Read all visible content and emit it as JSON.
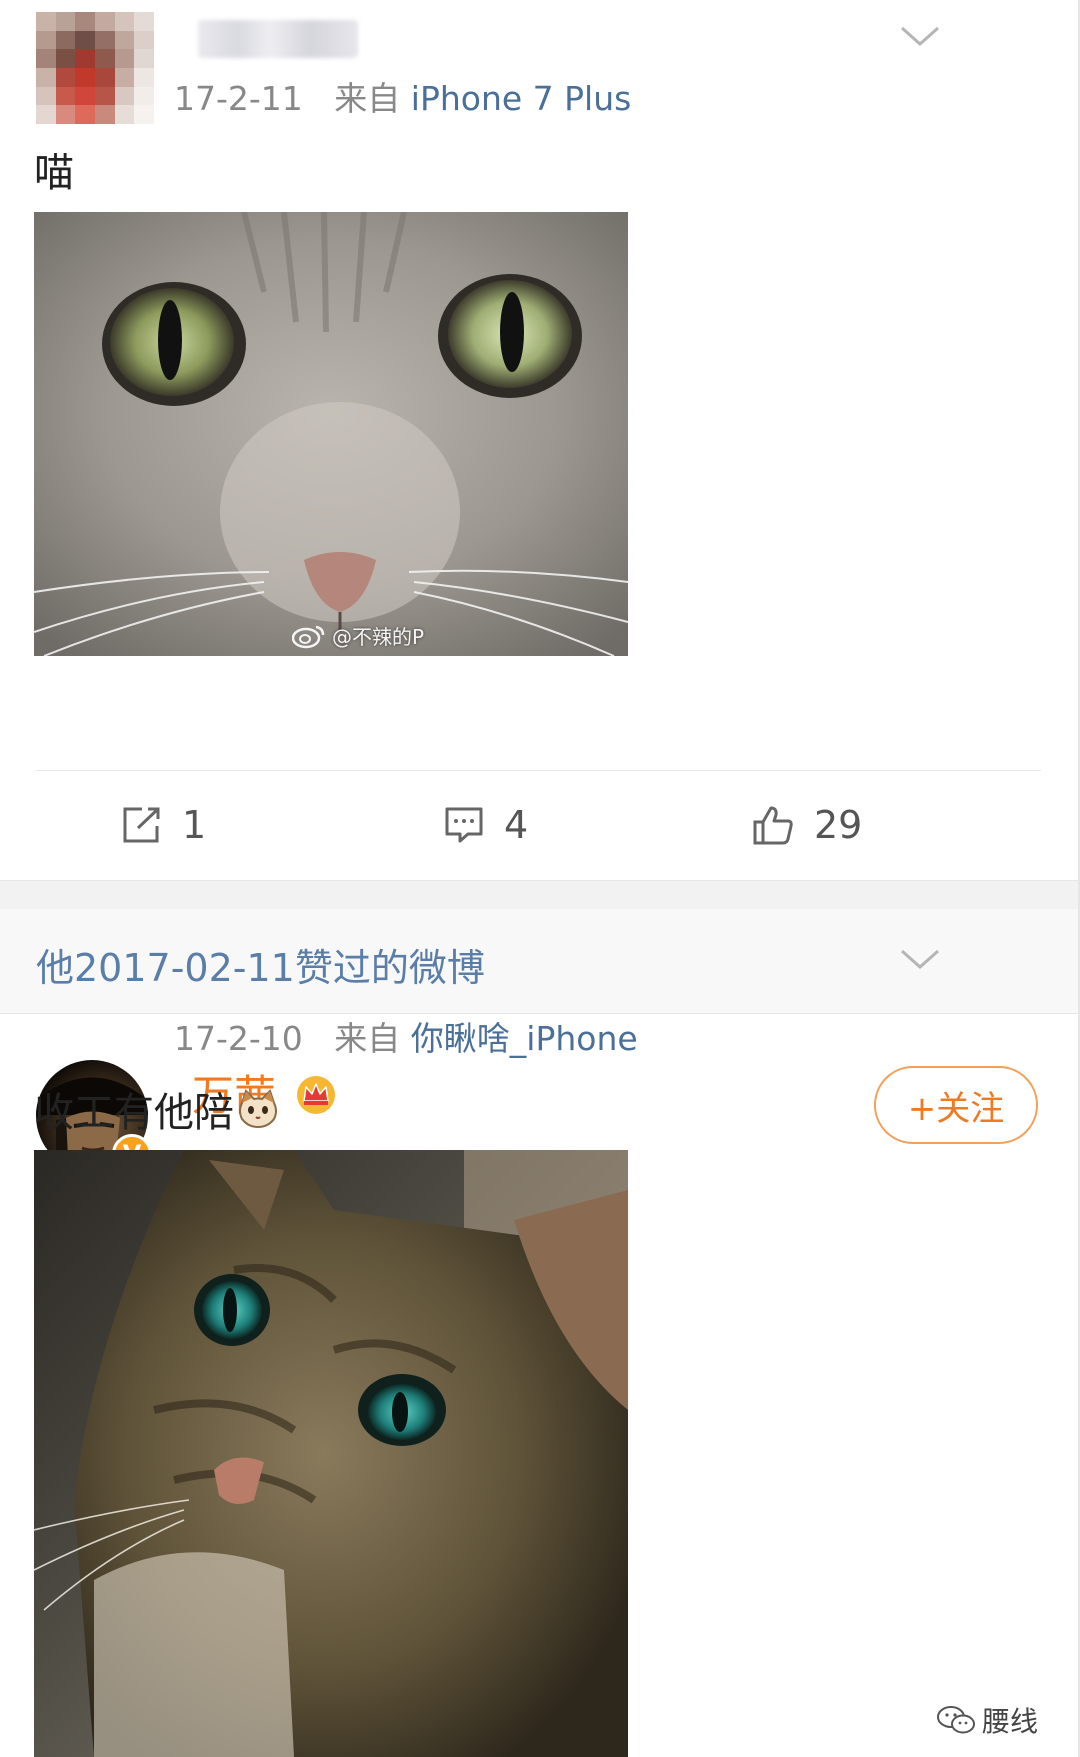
{
  "post1": {
    "date": "17-2-11",
    "source_prefix": "来自",
    "source": "iPhone 7 Plus",
    "text": "喵",
    "image_watermark": "@不辣的P",
    "actions": {
      "repost_count": "1",
      "comment_count": "4",
      "like_count": "29"
    }
  },
  "liked_section": {
    "title": "他2017-02-11赞过的微博"
  },
  "post2": {
    "username": "万茜",
    "verified_badge": "V",
    "date": "17-2-10",
    "source_prefix": "来自",
    "source": "你瞅啥_iPhone",
    "text": "收工有他陪",
    "follow_label": "+关注"
  },
  "watermark_brand": "腰线",
  "icons": [
    "chevron-down-icon",
    "repost-icon",
    "comment-icon",
    "like-icon",
    "crown-icon",
    "cat-emoji-icon",
    "weibo-logo-icon",
    "wechat-icon"
  ],
  "colors": {
    "link": "#4a6f98",
    "section_title": "#5b7ea8",
    "accent_orange": "#f07a22",
    "meta_gray": "#888888"
  }
}
